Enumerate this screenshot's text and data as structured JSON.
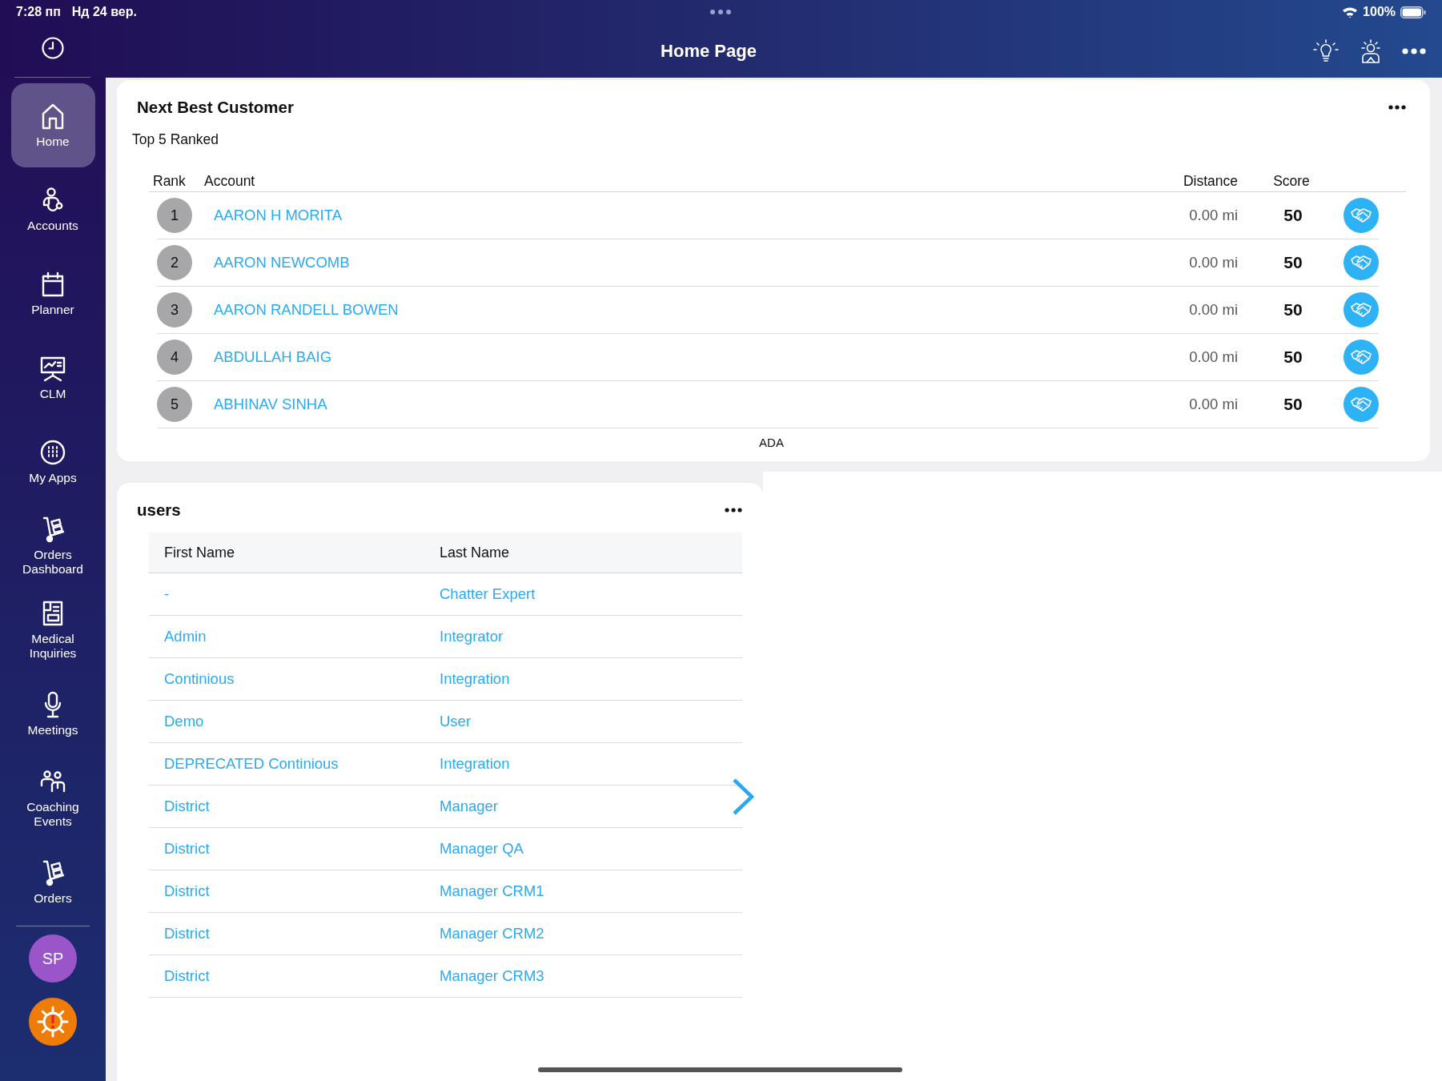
{
  "status_bar": {
    "time": "7:28 пп",
    "date": "Нд 24 вер.",
    "battery": "100%"
  },
  "nav_bar": {
    "title": "Home Page"
  },
  "sidebar": {
    "items": [
      {
        "label": "Home",
        "selected": true
      },
      {
        "label": "Accounts",
        "selected": false
      },
      {
        "label": "Planner",
        "selected": false
      },
      {
        "label": "CLM",
        "selected": false
      },
      {
        "label": "My Apps",
        "selected": false
      },
      {
        "label": "Orders Dashboard",
        "selected": false
      },
      {
        "label": "Medical Inquiries",
        "selected": false
      },
      {
        "label": "Meetings",
        "selected": false
      },
      {
        "label": "Coaching Events",
        "selected": false
      },
      {
        "label": "Orders",
        "selected": false
      }
    ],
    "avatar": {
      "initials": "SP"
    }
  },
  "next_best_customer": {
    "title": "Next Best Customer",
    "subtitle": "Top 5 Ranked",
    "columns": [
      "Rank",
      "Account",
      "Distance",
      "Score"
    ],
    "rows": [
      {
        "rank": "1",
        "account": "AARON H MORITA",
        "distance": "0.00 mi",
        "score": "50"
      },
      {
        "rank": "2",
        "account": "AARON NEWCOMB",
        "distance": "0.00 mi",
        "score": "50"
      },
      {
        "rank": "3",
        "account": "AARON RANDELL BOWEN",
        "distance": "0.00 mi",
        "score": "50"
      },
      {
        "rank": "4",
        "account": "ABDULLAH BAIG",
        "distance": "0.00 mi",
        "score": "50"
      },
      {
        "rank": "5",
        "account": "ABHINAV SINHA",
        "distance": "0.00 mi",
        "score": "50"
      }
    ],
    "footer": "ADA"
  },
  "users": {
    "title": "users",
    "columns": [
      "First Name",
      "Last Name"
    ],
    "rows": [
      {
        "first_name": "-",
        "last_name": "Chatter Expert"
      },
      {
        "first_name": "Admin",
        "last_name": "Integrator"
      },
      {
        "first_name": "Continious",
        "last_name": "Integration"
      },
      {
        "first_name": "Demo",
        "last_name": "User"
      },
      {
        "first_name": "DEPRECATED Continious",
        "last_name": "Integration"
      },
      {
        "first_name": "District",
        "last_name": "Manager"
      },
      {
        "first_name": "District",
        "last_name": "Manager QA"
      },
      {
        "first_name": "District",
        "last_name": "Manager CRM1"
      },
      {
        "first_name": "District",
        "last_name": "Manager CRM2"
      },
      {
        "first_name": "District",
        "last_name": "Manager CRM3"
      }
    ]
  }
}
